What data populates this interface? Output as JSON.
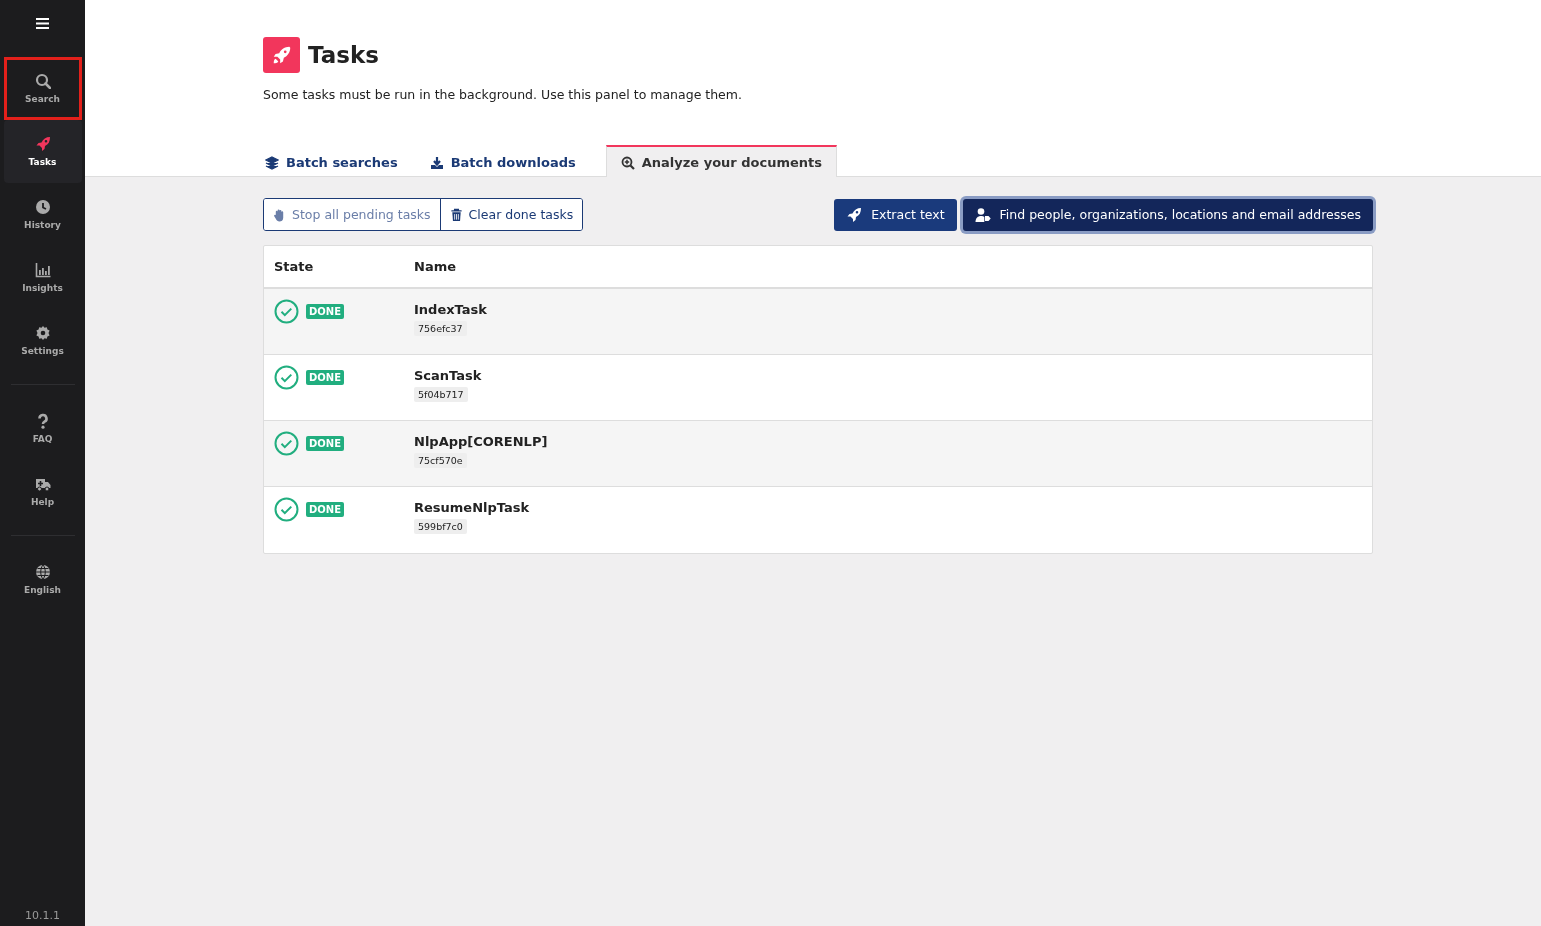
{
  "sidebar": {
    "groups": [
      [
        {
          "label": "Search",
          "selected": false,
          "highlighted": true
        },
        {
          "label": "Tasks",
          "selected": true,
          "highlighted": false
        },
        {
          "label": "History",
          "selected": false,
          "highlighted": false
        },
        {
          "label": "Insights",
          "selected": false,
          "highlighted": false
        },
        {
          "label": "Settings",
          "selected": false,
          "highlighted": false
        }
      ],
      [
        {
          "label": "FAQ",
          "selected": false,
          "highlighted": false
        },
        {
          "label": "Help",
          "selected": false,
          "highlighted": false
        }
      ],
      [
        {
          "label": "English",
          "selected": false,
          "highlighted": false
        }
      ]
    ],
    "version": "10.1.1"
  },
  "page": {
    "title": "Tasks",
    "description": "Some tasks must be run in the background. Use this panel to manage them."
  },
  "tabs": [
    {
      "label": "Batch searches",
      "selected": false
    },
    {
      "label": "Batch downloads",
      "selected": false
    },
    {
      "label": "Analyze your documents",
      "selected": true
    }
  ],
  "toolbar": {
    "left": [
      {
        "label": "Stop all pending tasks",
        "disabled": true
      },
      {
        "label": "Clear done tasks",
        "disabled": false
      }
    ],
    "right": [
      {
        "label": "Extract text",
        "focused": false
      },
      {
        "label": "Find people, organizations, locations and email addresses",
        "focused": true
      }
    ]
  },
  "table": {
    "columns": [
      "State",
      "Name"
    ],
    "rows": [
      {
        "state": "DONE",
        "name": "IndexTask",
        "id": "756efc37"
      },
      {
        "state": "DONE",
        "name": "ScanTask",
        "id": "5f04b717"
      },
      {
        "state": "DONE",
        "name": "NlpApp[CORENLP]",
        "id": "75cf570e"
      },
      {
        "state": "DONE",
        "name": "ResumeNlpTask",
        "id": "599bf7c0"
      }
    ]
  }
}
